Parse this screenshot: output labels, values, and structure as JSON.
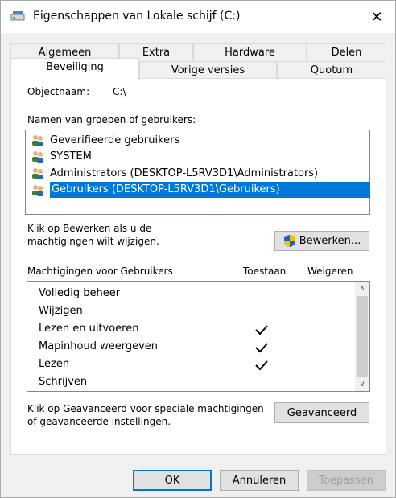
{
  "window": {
    "title": "Eigenschappen van Lokale schijf (C:)",
    "close_glyph": "✕"
  },
  "tabs_row1": [
    "Algemeen",
    "Extra",
    "Hardware",
    "Delen"
  ],
  "tabs_row2": [
    "Beveiliging",
    "Vorige versies",
    "Quotum"
  ],
  "active_tab": "Beveiliging",
  "object": {
    "label": "Objectnaam:",
    "value": "C:\\"
  },
  "groups": {
    "label": "Namen van groepen of gebruikers:",
    "items": [
      "Geverifieerde gebruikers",
      "SYSTEM",
      "Administrators (DESKTOP-L5RV3D1\\Administrators)",
      "Gebruikers (DESKTOP-L5RV3D1\\Gebruikers)"
    ],
    "selected_index": 3
  },
  "edit": {
    "hint_line1": "Klik op Bewerken als u de",
    "hint_line2": "machtigingen wilt wijzigen.",
    "button_label": "Bewerken..."
  },
  "permissions": {
    "title": "Machtigingen voor Gebruikers",
    "allow_header": "Toestaan",
    "deny_header": "Weigeren",
    "rows": [
      {
        "name": "Volledig beheer",
        "allow": false,
        "deny": false
      },
      {
        "name": "Wijzigen",
        "allow": false,
        "deny": false
      },
      {
        "name": "Lezen en uitvoeren",
        "allow": true,
        "deny": false
      },
      {
        "name": "Mapinhoud weergeven",
        "allow": true,
        "deny": false
      },
      {
        "name": "Lezen",
        "allow": true,
        "deny": false
      },
      {
        "name": "Schrijven",
        "allow": false,
        "deny": false
      }
    ]
  },
  "advanced": {
    "hint_line1": "Klik op Geavanceerd voor speciale machtigingen",
    "hint_line2": "of geavanceerde instellingen.",
    "button_label": "Geavanceerd"
  },
  "footer": {
    "ok": "OK",
    "cancel": "Annuleren",
    "apply": "Toepassen"
  },
  "colors": {
    "selection": "#0078d7",
    "shield_blue": "#1f5fbf",
    "shield_yellow": "#f2c200"
  }
}
